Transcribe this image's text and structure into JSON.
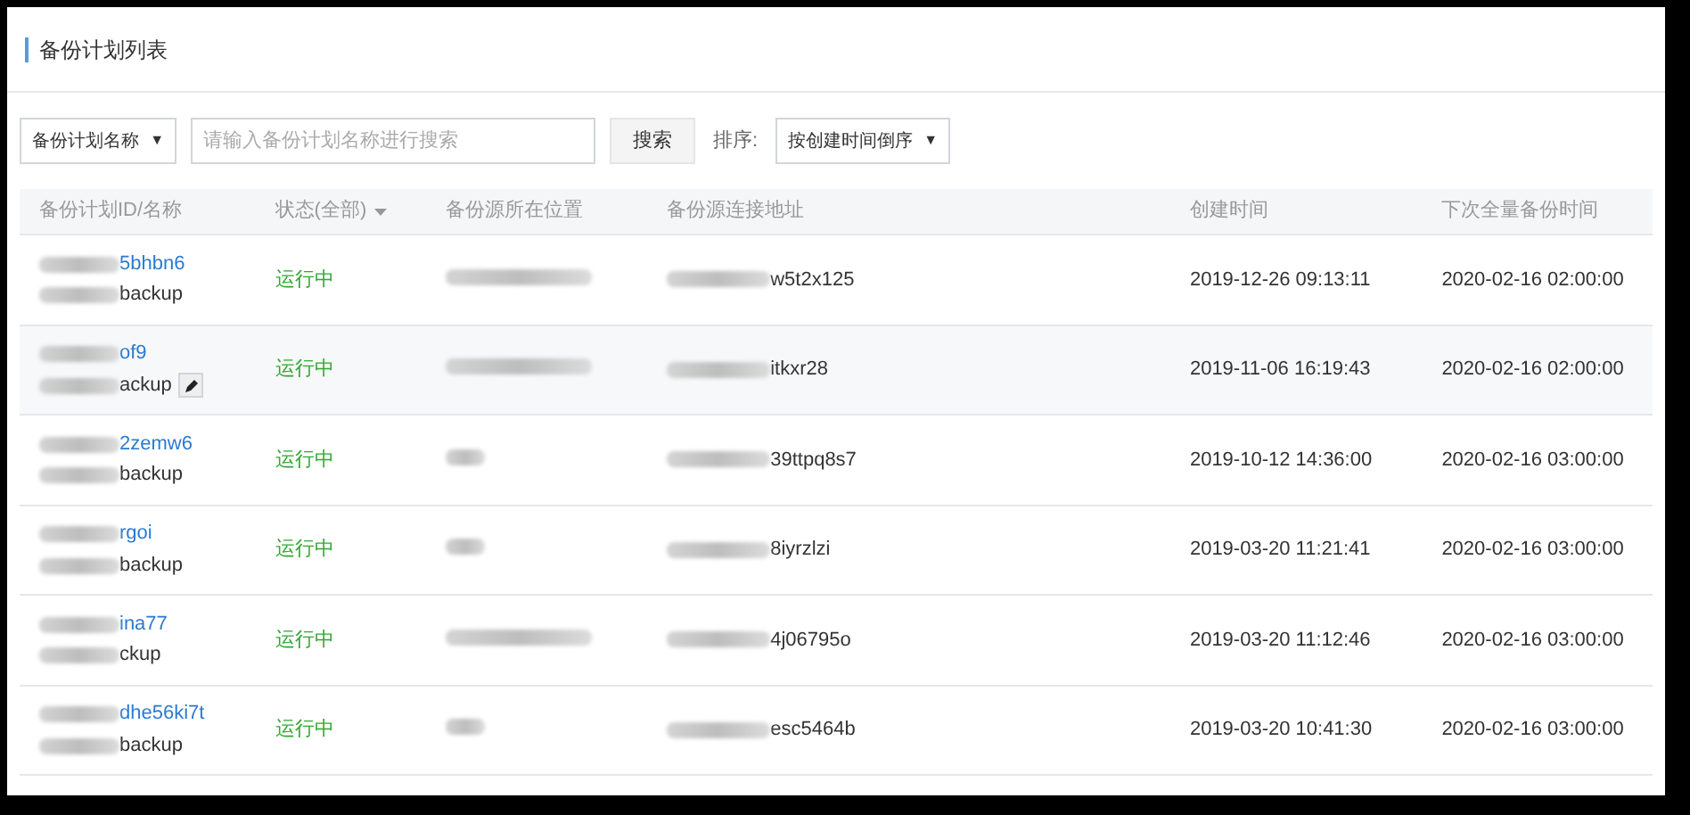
{
  "title": "备份计划列表",
  "toolbar": {
    "field_select": "备份计划名称",
    "caret": "▼",
    "search": {
      "placeholder": "请输入备份计划名称进行搜索"
    },
    "search_button": "搜索",
    "sort_label": "排序:",
    "sort_select": "按创建时间倒序",
    "sort_caret": "▼"
  },
  "table": {
    "columns": [
      {
        "label": "备份计划ID/名称"
      },
      {
        "label": "状态(全部)",
        "filter": true
      },
      {
        "label": "备份源所在位置"
      },
      {
        "label": "备份源连接地址"
      },
      {
        "label": "创建时间"
      },
      {
        "label": "下次全量备份时间"
      }
    ],
    "rows": [
      {
        "id": "5bhbn6",
        "name": "backup",
        "status": "运行中",
        "location": {
          "kind": "long"
        },
        "address": "w5t2x125",
        "created": "2019-12-26 09:13:11",
        "next_backup": "2020-02-16 02:00:00",
        "hovered": false
      },
      {
        "id": "of9",
        "name": "ackup",
        "status": "运行中",
        "location": {
          "kind": "long"
        },
        "address": "itkxr28",
        "created": "2019-11-06 16:19:43",
        "next_backup": "2020-02-16 02:00:00",
        "hovered": true
      },
      {
        "id": "2zemw6",
        "name": "backup",
        "status": "运行中",
        "location": {
          "kind": "short"
        },
        "address": "39ttpq8s7",
        "created": "2019-10-12 14:36:00",
        "next_backup": "2020-02-16 03:00:00",
        "hovered": false
      },
      {
        "id": "rgoi",
        "name": "backup",
        "status": "运行中",
        "location": {
          "kind": "short"
        },
        "address": "8iyrzlzi",
        "created": "2019-03-20 11:21:41",
        "next_backup": "2020-02-16 03:00:00",
        "hovered": false
      },
      {
        "id": "ina77",
        "name": "ckup",
        "status": "运行中",
        "location": {
          "kind": "long"
        },
        "address": "4j06795o",
        "created": "2019-03-20 11:12:46",
        "next_backup": "2020-02-16 03:00:00",
        "hovered": false
      },
      {
        "id": "dhe56ki7t",
        "name": "backup",
        "status": "运行中",
        "location": {
          "kind": "short"
        },
        "address": "esc5464b",
        "created": "2019-03-20 10:41:30",
        "next_backup": "2020-02-16 03:00:00",
        "hovered": false
      }
    ]
  }
}
